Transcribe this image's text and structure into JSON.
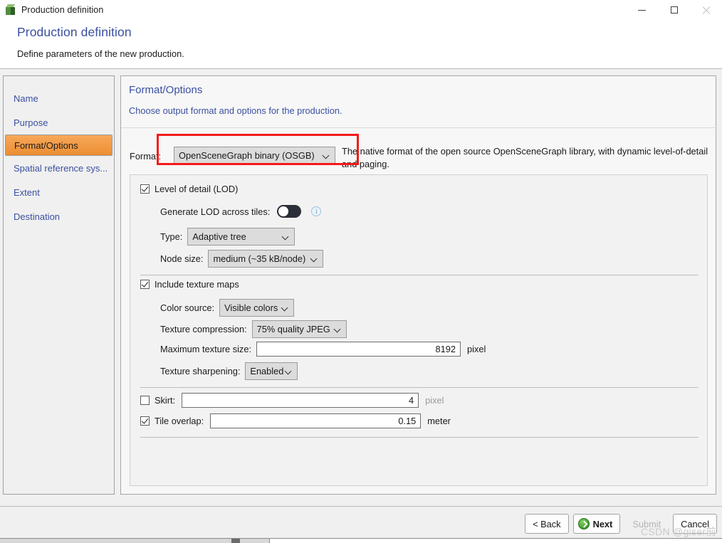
{
  "window": {
    "title": "Production definition",
    "icon": "cube-icon",
    "minimize_label": "Minimize",
    "maximize_label": "Maximize",
    "close_label": "Close"
  },
  "header": {
    "title": "Production definition",
    "subtitle": "Define parameters of the new production."
  },
  "sidebar": {
    "items": [
      {
        "label": "Name",
        "active": false
      },
      {
        "label": "Purpose",
        "active": false
      },
      {
        "label": "Format/Options",
        "active": true
      },
      {
        "label": "Spatial reference sys...",
        "active": false
      },
      {
        "label": "Extent",
        "active": false
      },
      {
        "label": "Destination",
        "active": false
      }
    ]
  },
  "panel": {
    "title": "Format/Options",
    "subtitle": "Choose output format and options for the production.",
    "format": {
      "label": "Format:",
      "value": "OpenSceneGraph binary (OSGB)",
      "description": "The native format of the open source OpenSceneGraph library, with dynamic level-of-detail and paging.",
      "highlight_color": "#f41a1a"
    },
    "lod": {
      "checkbox_label": "Level of detail (LOD)",
      "checked": true,
      "generate_across_tiles_label": "Generate LOD across tiles:",
      "generate_across_tiles_value": "off",
      "info_glyph": "i",
      "type_label": "Type:",
      "type_value": "Adaptive tree",
      "node_size_label": "Node size:",
      "node_size_value": "medium (~35 kB/node)"
    },
    "textures": {
      "checkbox_label": "Include texture maps",
      "checked": true,
      "color_source_label": "Color source:",
      "color_source_value": "Visible colors",
      "compression_label": "Texture compression:",
      "compression_value": "75% quality JPEG",
      "max_size_label": "Maximum texture size:",
      "max_size_value": "8192",
      "max_size_unit": "pixel",
      "sharpening_label": "Texture sharpening:",
      "sharpening_value": "Enabled"
    },
    "geometry": {
      "skirt_label": "Skirt:",
      "skirt_checked": false,
      "skirt_value": "4",
      "skirt_unit": "pixel",
      "tile_overlap_label": "Tile overlap:",
      "tile_overlap_checked": true,
      "tile_overlap_value": "0.15",
      "tile_overlap_unit": "meter"
    }
  },
  "footer": {
    "back_label": "< Back",
    "next_label": "Next",
    "submit_label": "Submit",
    "cancel_label": "Cancel",
    "watermark": "CSDN @giser前"
  }
}
